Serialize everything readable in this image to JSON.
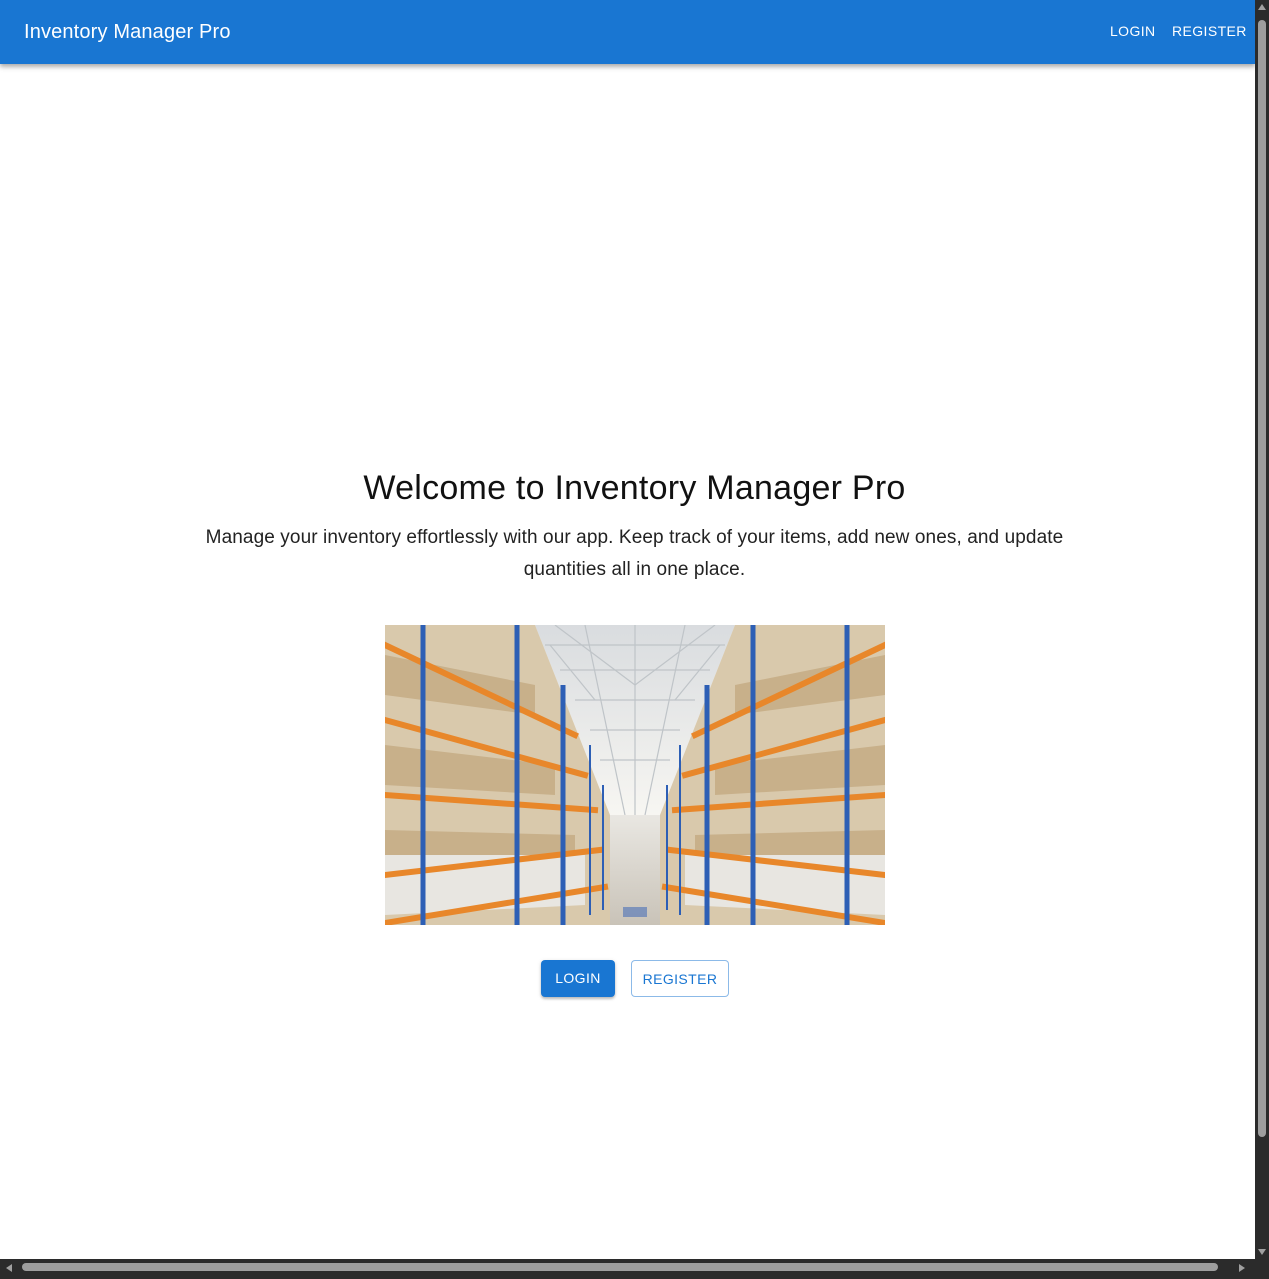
{
  "appbar": {
    "title": "Inventory Manager Pro",
    "nav": {
      "login_label": "LOGIN",
      "register_label": "REGISTER"
    },
    "color": "#1976d2"
  },
  "hero": {
    "title": "Welcome to Inventory Manager Pro",
    "description": "Manage your inventory effortlessly with our app. Keep track of your items, add new ones, and update quantities all in one place.",
    "image": {
      "alt": "Warehouse aisle with stocked shelves",
      "icon": "warehouse-photo"
    }
  },
  "actions": {
    "login_label": "LOGIN",
    "register_label": "REGISTER"
  },
  "colors": {
    "primary": "#1976d2",
    "rack_orange": "#e8872a",
    "rack_blue": "#2d5fb5"
  }
}
